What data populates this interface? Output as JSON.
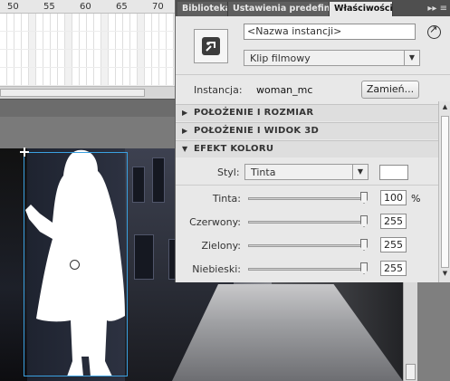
{
  "timeline": {
    "ruler": [
      "50",
      "55",
      "60",
      "65",
      "70"
    ]
  },
  "panel": {
    "tabs": [
      {
        "label": "Biblioteka"
      },
      {
        "label": "Ustawienia predefiniow"
      },
      {
        "label": "Właściwości"
      }
    ],
    "tab_menu": "▸▸ ≡",
    "instance_name_placeholder": "<Nazwa instancji>",
    "symbol_type": "Klip filmowy",
    "instance_label": "Instancja:",
    "instance_value": "woman_mc",
    "swap_button": "Zamień...",
    "sections": [
      {
        "label": "POŁOŻENIE I ROZMIAR",
        "expanded": false
      },
      {
        "label": "POŁOŻENIE I WIDOK 3D",
        "expanded": false
      },
      {
        "label": "EFEKT KOLORU",
        "expanded": true
      }
    ],
    "style_label": "Styl:",
    "style_value": "Tinta",
    "tint_color": "#ffffff",
    "sliders": [
      {
        "label": "Tinta:",
        "value": "100",
        "unit": "%",
        "level": 1.0
      },
      {
        "label": "Czerwony:",
        "value": "255",
        "unit": "",
        "level": 1.0
      },
      {
        "label": "Zielony:",
        "value": "255",
        "unit": "",
        "level": 1.0
      },
      {
        "label": "Niebieski:",
        "value": "255",
        "unit": "",
        "level": 1.0
      }
    ]
  },
  "colors": {
    "selection": "#3aa0e0",
    "panel_bg": "#e8e8e8",
    "tab_bar": "#4f4f4f"
  },
  "icons": {
    "symbol": "movie-clip-symbol-icon",
    "edit": "edit-symbol-icon",
    "expand": "triangle-right-icon",
    "collapse": "triangle-down-icon"
  }
}
